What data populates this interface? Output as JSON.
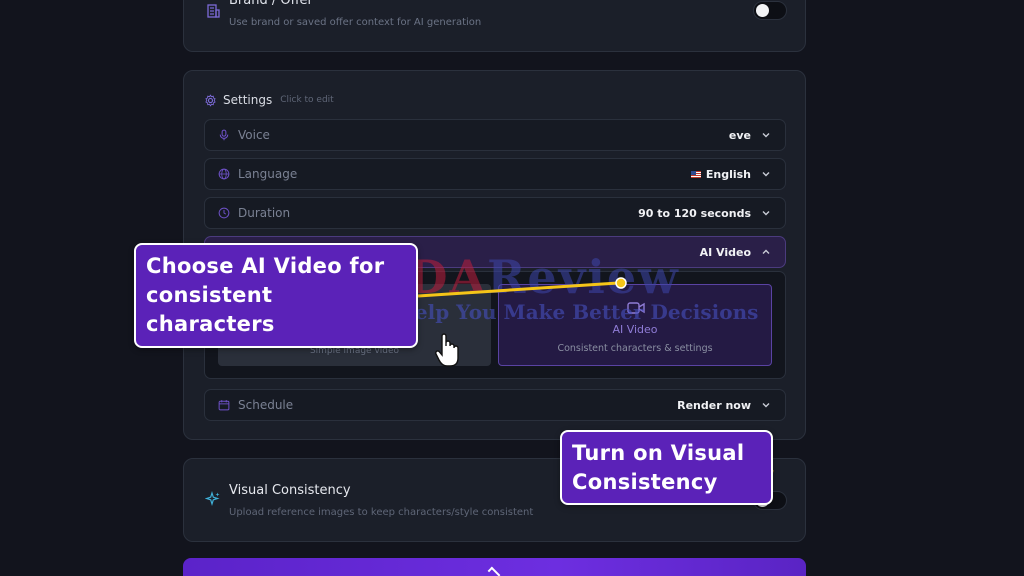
{
  "brand": {
    "title": "Brand / Offer",
    "subtitle": "Use brand or saved offer context for AI generation"
  },
  "settings": {
    "title": "Settings",
    "hint": "Click to edit",
    "rows": {
      "voice": {
        "label": "Voice",
        "value": "eve"
      },
      "language": {
        "label": "Language",
        "value": "English"
      },
      "duration": {
        "label": "Duration",
        "value": "90 to 120 seconds"
      },
      "style": {
        "label": "",
        "value": "AI Video"
      },
      "schedule": {
        "label": "Schedule",
        "value": "Render now"
      }
    },
    "style_options": {
      "left_subtitle": "Simple image video",
      "right_title": "AI Video",
      "right_subtitle": "Consistent characters & settings"
    }
  },
  "visual_consistency": {
    "title": "Visual Consistency",
    "subtitle": "Upload reference images to keep characters/style consistent"
  },
  "annotations": {
    "ai_video_callout": "Choose AI Video for consistent characters",
    "vc_callout": "Turn on Visual Consistency"
  },
  "watermark": {
    "brand_a": "HUDA",
    "brand_b": "Review",
    "tagline": "Help You Make Better Decisions"
  },
  "colors": {
    "accent": "#6d2ee0",
    "callout": "#5b22b8",
    "arrow": "#f5c518",
    "background": "#12141d",
    "card": "#1b1f29"
  }
}
